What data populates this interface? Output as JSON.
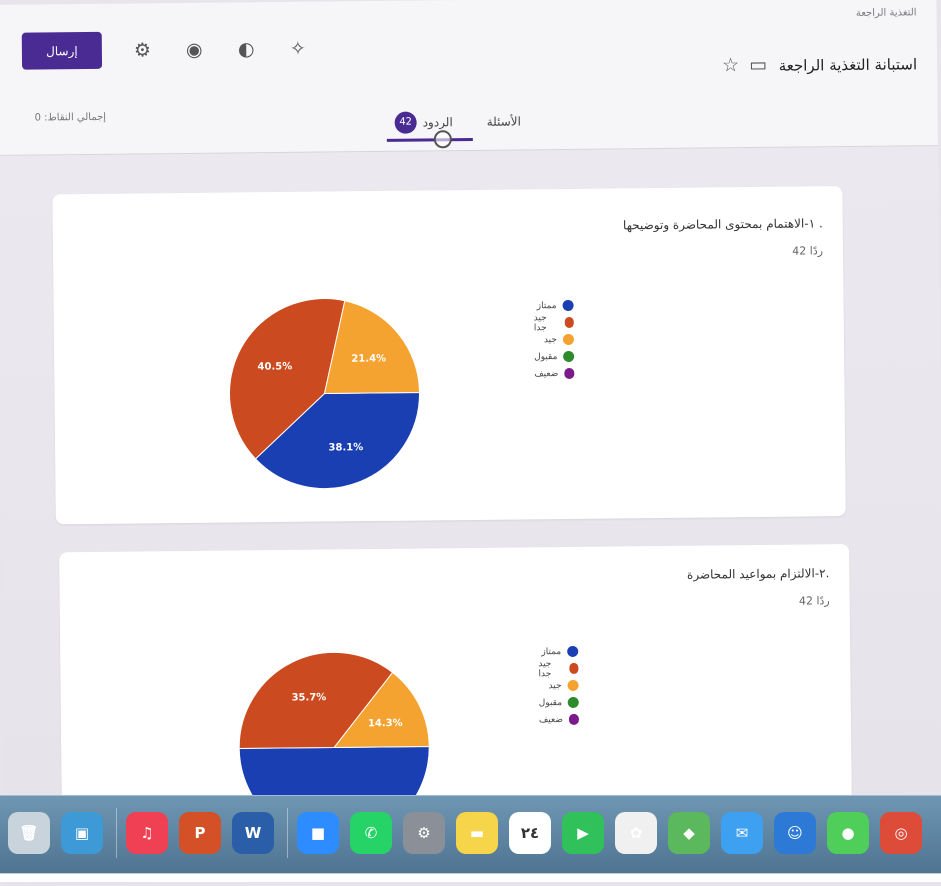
{
  "header": {
    "doc_title_small": "التغذية الراجعة",
    "form_title": "استبانة التغذية الراجعة",
    "send_label": "إرسال",
    "points_label": "إجمالي النقاط: 0",
    "tabs": {
      "questions": "الأسئلة",
      "responses": "الردود",
      "responses_count": "42"
    }
  },
  "questions": [
    {
      "title": "١-الاهتمام بمحتوى المحاضرة وتوضيحها .",
      "count": "42 ردًا",
      "chart_data": {
        "type": "pie",
        "legend": [
          "ممتاز",
          "جيد جدا",
          "جيد",
          "مقبول",
          "ضعيف"
        ],
        "colors": [
          "#1a3fb3",
          "#cc4a1f",
          "#f5a330",
          "#2d8a2d",
          "#7b1a8a"
        ],
        "values": [
          38.1,
          40.5,
          21.4,
          0,
          0
        ],
        "labels": [
          "38.1%",
          "40.5%",
          "21.4%",
          "",
          ""
        ]
      }
    },
    {
      "title": "٢-الالتزام بمواعيد المحاضرة.",
      "count": "42 ردًا",
      "chart_data": {
        "type": "pie",
        "legend": [
          "ممتاز",
          "جيد جدا",
          "جيد",
          "مقبول",
          "ضعيف"
        ],
        "colors": [
          "#1a3fb3",
          "#cc4a1f",
          "#f5a330",
          "#2d8a2d",
          "#7b1a8a"
        ],
        "values": [
          50.0,
          35.7,
          14.3,
          0,
          0
        ],
        "labels": [
          "",
          "35.7%",
          "14.3%",
          "",
          ""
        ]
      }
    }
  ],
  "dock": {
    "calendar_day": "٢٤",
    "items": [
      {
        "name": "trash-icon",
        "color": "#c9d3dc"
      },
      {
        "name": "files-icon",
        "color": "#3d9ad6"
      },
      {
        "name": "music-icon",
        "color": "#ef4054"
      },
      {
        "name": "powerpoint-icon",
        "color": "#d45026"
      },
      {
        "name": "word-icon",
        "color": "#2b5ea8"
      },
      {
        "name": "zoom-icon",
        "color": "#2d8cff"
      },
      {
        "name": "whatsapp-icon",
        "color": "#25d366"
      },
      {
        "name": "settings-icon",
        "color": "#8a8f98"
      },
      {
        "name": "notes-icon",
        "color": "#f6d54a"
      },
      {
        "name": "calendar-icon",
        "color": "#ffffff"
      },
      {
        "name": "facetime-icon",
        "color": "#30c15a"
      },
      {
        "name": "photos-icon",
        "color": "#f0f0f0"
      },
      {
        "name": "maps-icon",
        "color": "#5cb85c"
      },
      {
        "name": "mail-icon",
        "color": "#3ea0f0"
      },
      {
        "name": "finder-icon",
        "color": "#2d7ad6"
      },
      {
        "name": "messages-icon",
        "color": "#4fcf5a"
      },
      {
        "name": "chrome-icon",
        "color": "#dd4b39"
      }
    ]
  }
}
